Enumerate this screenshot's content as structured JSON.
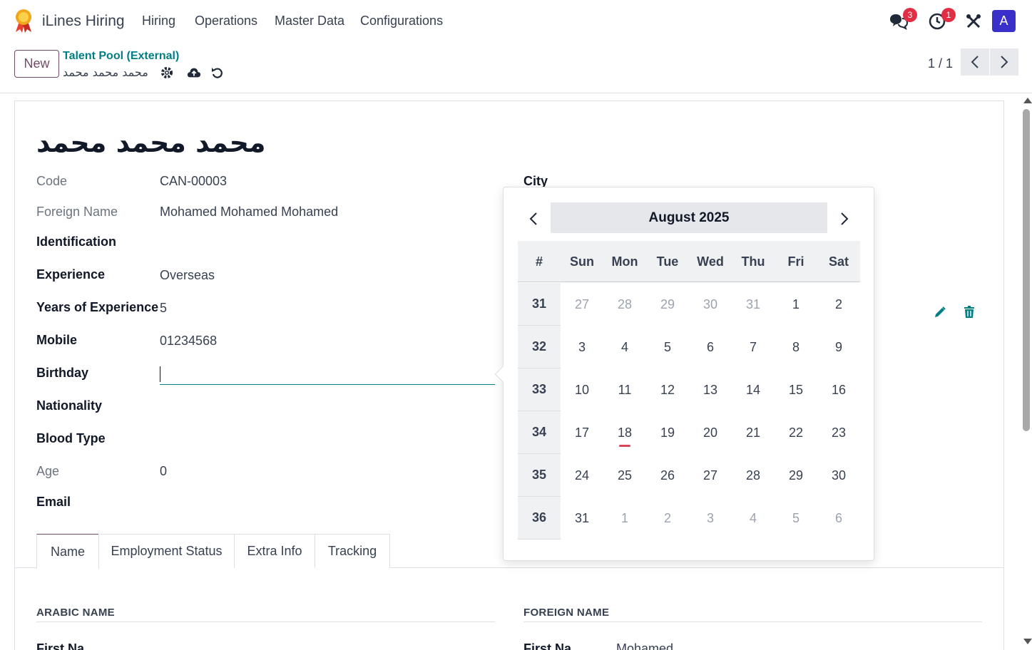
{
  "navbar": {
    "app_name": "iLines Hiring",
    "menu": [
      "Hiring",
      "Operations",
      "Master Data",
      "Configurations"
    ],
    "messages_badge": "3",
    "activities_badge": "1",
    "avatar_letter": "A"
  },
  "control_panel": {
    "new_label": "New",
    "breadcrumb": "Talent Pool (External)",
    "record_name": "محمد محمد محمد",
    "pager": "1 / 1"
  },
  "form": {
    "name": "محمد محمد محمد",
    "fields": {
      "code": {
        "label": "Code",
        "value": "CAN-00003"
      },
      "foreign_name": {
        "label": "Foreign Name",
        "value": "Mohamed Mohamed Mohamed"
      },
      "identification": {
        "label": "Identification",
        "value": ""
      },
      "experience": {
        "label": "Experience",
        "value": "Overseas"
      },
      "years_experience": {
        "label": "Years of Experience",
        "value": "5"
      },
      "mobile": {
        "label": "Mobile",
        "value": "01234568"
      },
      "birthday": {
        "label": "Birthday",
        "value": ""
      },
      "nationality": {
        "label": "Nationality",
        "value": ""
      },
      "blood_type": {
        "label": "Blood Type",
        "value": ""
      },
      "age": {
        "label": "Age",
        "value": "0"
      },
      "email": {
        "label": "Email",
        "value": ""
      },
      "city": {
        "label": "City",
        "value": ""
      }
    },
    "tabs": [
      "Name",
      "Employment Status",
      "Extra Info",
      "Tracking"
    ],
    "sections": {
      "arabic_name": "ARABIC NAME",
      "foreign_name": "FOREIGN NAME"
    },
    "peek": {
      "left": "First Na",
      "right_label": "First Na",
      "right_value": "Mohamed"
    }
  },
  "datepicker": {
    "month_label": "August 2025",
    "week_header": "#",
    "weekdays": [
      "Sun",
      "Mon",
      "Tue",
      "Wed",
      "Thu",
      "Fri",
      "Sat"
    ],
    "today": "18",
    "weeks": [
      {
        "num": "31",
        "days": [
          [
            "27",
            1
          ],
          [
            "28",
            1
          ],
          [
            "29",
            1
          ],
          [
            "30",
            1
          ],
          [
            "31",
            1
          ],
          [
            "1",
            0
          ],
          [
            "2",
            0
          ]
        ]
      },
      {
        "num": "32",
        "days": [
          [
            "3",
            0
          ],
          [
            "4",
            0
          ],
          [
            "5",
            0
          ],
          [
            "6",
            0
          ],
          [
            "7",
            0
          ],
          [
            "8",
            0
          ],
          [
            "9",
            0
          ]
        ]
      },
      {
        "num": "33",
        "days": [
          [
            "10",
            0
          ],
          [
            "11",
            0
          ],
          [
            "12",
            0
          ],
          [
            "13",
            0
          ],
          [
            "14",
            0
          ],
          [
            "15",
            0
          ],
          [
            "16",
            0
          ]
        ]
      },
      {
        "num": "34",
        "days": [
          [
            "17",
            0
          ],
          [
            "18",
            0
          ],
          [
            "19",
            0
          ],
          [
            "20",
            0
          ],
          [
            "21",
            0
          ],
          [
            "22",
            0
          ],
          [
            "23",
            0
          ]
        ]
      },
      {
        "num": "35",
        "days": [
          [
            "24",
            0
          ],
          [
            "25",
            0
          ],
          [
            "26",
            0
          ],
          [
            "27",
            0
          ],
          [
            "28",
            0
          ],
          [
            "29",
            0
          ],
          [
            "30",
            0
          ]
        ]
      },
      {
        "num": "36",
        "days": [
          [
            "31",
            0
          ],
          [
            "1",
            1
          ],
          [
            "2",
            1
          ],
          [
            "3",
            1
          ],
          [
            "4",
            1
          ],
          [
            "5",
            1
          ],
          [
            "6",
            1
          ]
        ]
      }
    ]
  },
  "colors": {
    "brand": "#714b67",
    "accent": "#017e84",
    "badge": "#e02f44",
    "avatar": "#3a2fc9"
  },
  "icons": [
    "ribbon-logo-icon",
    "chat-icon",
    "clock-icon",
    "tools-icon",
    "gear-icon",
    "cloud-upload-icon",
    "undo-icon",
    "chevron-left-icon",
    "chevron-right-icon",
    "pencil-icon",
    "trash-icon"
  ]
}
